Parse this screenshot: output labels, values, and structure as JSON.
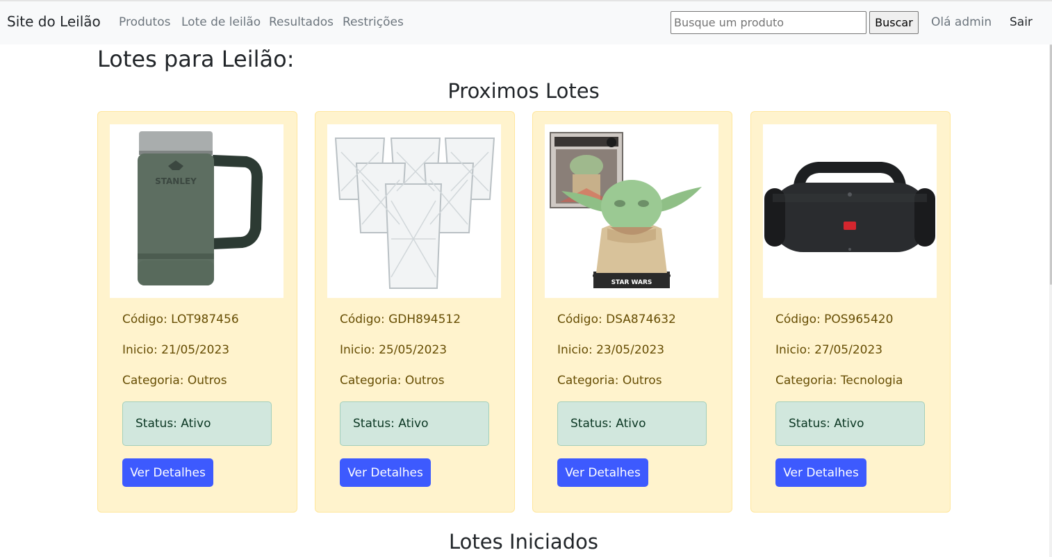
{
  "navbar": {
    "brand": "Site do Leilão",
    "links": [
      "Produtos",
      "Lote de leilão",
      "Resultados",
      "Restrições"
    ],
    "search_placeholder": "Busque um produto",
    "search_button": "Buscar",
    "greeting": "Olá admin",
    "logout": "Sair"
  },
  "page": {
    "title": "Lotes para Leilão:",
    "upcoming_section": "Proximos Lotes",
    "started_section": "Lotes Iniciados"
  },
  "cards": [
    {
      "code": "Código: LOT987456",
      "start": "Inicio: 21/05/2023",
      "category": "Categoria: Outros",
      "status": "Status: Ativo",
      "button": "Ver Detalhes",
      "image_icon": "beer-mug-image"
    },
    {
      "code": "Código: GDH894512",
      "start": "Inicio: 25/05/2023",
      "category": "Categoria: Outros",
      "status": "Status: Ativo",
      "button": "Ver Detalhes",
      "image_icon": "glasses-set-image"
    },
    {
      "code": "Código: DSA874632",
      "start": "Inicio: 23/05/2023",
      "category": "Categoria: Outros",
      "status": "Status: Ativo",
      "button": "Ver Detalhes",
      "image_icon": "figure-toy-image"
    },
    {
      "code": "Código: POS965420",
      "start": "Inicio: 27/05/2023",
      "category": "Categoria: Tecnologia",
      "status": "Status: Ativo",
      "button": "Ver Detalhes",
      "image_icon": "speaker-image"
    }
  ],
  "colors": {
    "card_bg": "#fff3cd",
    "card_text": "#664d03",
    "status_bg": "#d1e7dd",
    "status_text": "#0a3622",
    "button_bg": "#3d5afe"
  }
}
